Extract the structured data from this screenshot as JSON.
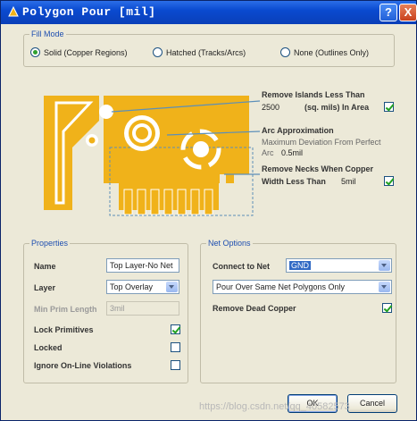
{
  "title": "Polygon Pour [mil]",
  "titlebar": {
    "help": "?",
    "close": "X"
  },
  "fill_mode": {
    "legend": "Fill Mode",
    "options": [
      {
        "label": "Solid (Copper Regions)",
        "selected": true
      },
      {
        "label": "Hatched (Tracks/Arcs)",
        "selected": false
      },
      {
        "label": "None (Outlines Only)",
        "selected": false
      }
    ]
  },
  "illustration": {
    "islands": {
      "title": "Remove Islands Less Than",
      "value": "2500",
      "unit": "(sq. mils) In Area",
      "checked": true
    },
    "arc": {
      "title": "Arc Approximation",
      "desc1": "Maximum Deviation From Perfect",
      "desc2_label": "Arc",
      "desc2_value": "0.5mil"
    },
    "necks": {
      "title": "Remove Necks When Copper",
      "label": "Width Less Than",
      "value": "5mil",
      "checked": true
    },
    "colors": {
      "copper": "#f0b21a",
      "arrow": "#5b8fb9"
    }
  },
  "properties": {
    "legend": "Properties",
    "name_label": "Name",
    "name_value": "Top Layer-No Net",
    "layer_label": "Layer",
    "layer_value": "Top Overlay",
    "min_prim_label": "Min Prim Length",
    "min_prim_value": "3mil",
    "lock_primitives_label": "Lock Primitives",
    "lock_primitives_checked": true,
    "locked_label": "Locked",
    "locked_checked": false,
    "ignore_label": "Ignore On-Line Violations",
    "ignore_checked": false
  },
  "net_options": {
    "legend": "Net Options",
    "connect_label": "Connect to Net",
    "connect_value": "GND",
    "pour_over_value": "Pour Over Same Net Polygons Only",
    "remove_dead_label": "Remove Dead Copper",
    "remove_dead_checked": true
  },
  "buttons": {
    "ok": "OK",
    "cancel": "Cancel"
  },
  "watermark": "https://blog.csdn.net/qq_40582573"
}
